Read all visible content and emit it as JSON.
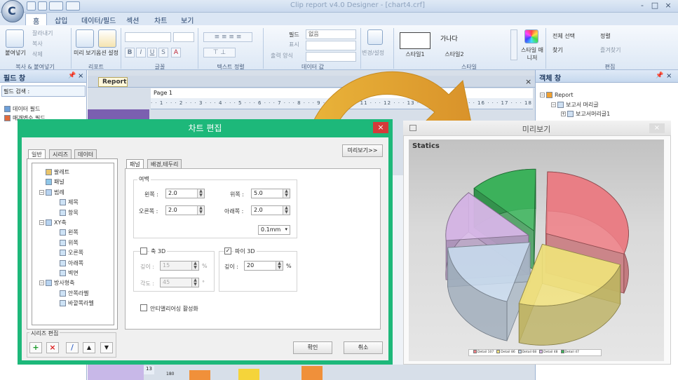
{
  "window": {
    "title": "Clip report v4.0 Designer - [chart4.crf]",
    "controls": [
      "-",
      "□",
      "×"
    ]
  },
  "ribbon": {
    "tabs": [
      "홈",
      "삽입",
      "데이터/필드",
      "섹션",
      "차트",
      "보기"
    ],
    "active_tab": "홈",
    "clipboard": {
      "paste": "붙여넣기",
      "cut": "잘라내기",
      "copy": "복사",
      "delete": "삭제",
      "group": "복사 & 붙여넣기"
    },
    "report": {
      "preview": "미리 보기",
      "option": "옵션 설정",
      "group": "리포트"
    },
    "font_group": "글꼴",
    "text_align_group": "텍스트 정렬",
    "data_value": {
      "field": "필드",
      "field_value": "없음",
      "format": "표시",
      "output_format": "출력 양식",
      "group": "데이터 값"
    },
    "change": {
      "label": "변경/설정"
    },
    "style": {
      "style1_sample": "",
      "style1": "스타일1",
      "style2_sample": "가나다",
      "style2": "스타일2",
      "manager": "스타일 매니저",
      "group": "스타일"
    },
    "edit": {
      "select_all": "전체 선택",
      "sort": "정렬",
      "find": "찾기",
      "favorite": "즐겨찾기",
      "group": "편집"
    }
  },
  "field_pane": {
    "title": "필드 창",
    "search_label": "필드 검색 :",
    "items": [
      "데이터 필드",
      "매개변수 필드"
    ]
  },
  "report_area": {
    "tab": "Report",
    "page_label": "Page 1",
    "ruler": "· · 1 · · · 2 · · · 3 · · · 4 · · · 5 · · · 6 · · · 7 · · · 8 · · · 9 · · · 10 · · · 11 · · · 12 · · · 13 · · · 14 · · · 15 · · · 16 · · · 17 · · · 18",
    "row_label_13": "13",
    "row_label_180": "180"
  },
  "object_pane": {
    "title": "객체 창",
    "items": [
      "Report",
      "보고서 머리글",
      "보고서머리글1"
    ]
  },
  "dialog": {
    "title": "차트 편집",
    "preview_button": "미리보기>>",
    "left_tabs": [
      "일반",
      "시리즈",
      "데이터"
    ],
    "tree": [
      {
        "label": "팔레트",
        "level": 1
      },
      {
        "label": "패널",
        "level": 1
      },
      {
        "label": "범례",
        "level": 1
      },
      {
        "label": "제목",
        "level": 2
      },
      {
        "label": "항목",
        "level": 2
      },
      {
        "label": "XY축",
        "level": 1
      },
      {
        "label": "왼쪽",
        "level": 2
      },
      {
        "label": "위쪽",
        "level": 2
      },
      {
        "label": "오른쪽",
        "level": 2
      },
      {
        "label": "아래쪽",
        "level": 2
      },
      {
        "label": "벽면",
        "level": 2
      },
      {
        "label": "방사형축",
        "level": 1
      },
      {
        "label": "안쪽라벨",
        "level": 2
      },
      {
        "label": "바깥쪽라벨",
        "level": 2
      }
    ],
    "series_edit_label": "시리즈 편집",
    "series_buttons": [
      "+",
      "×",
      "/",
      "▲",
      "▼"
    ],
    "prop_tabs": [
      "패널",
      "배경,테두리"
    ],
    "margin_label": "여백",
    "left_label": "왼쪽 :",
    "left_value": "2.0",
    "top_label": "위쪽 :",
    "top_value": "5.0",
    "right_label": "오른쪽 :",
    "right_value": "2.0",
    "bottom_label": "아래쪽 :",
    "bottom_value": "2.0",
    "unit": "0.1mm",
    "axis3d_label": "축 3D",
    "axis3d_checked": false,
    "depth_label": "깊이 :",
    "depth_value": "15",
    "depth_unit": "%",
    "angle_label": "각도 :",
    "angle_value": "45",
    "angle_unit": "°",
    "pie3d_label": "파이 3D",
    "pie3d_checked": true,
    "pie_depth_label": "깊이 :",
    "pie_depth_value": "20",
    "pie_depth_unit": "%",
    "antialias_label": "안티앨리어싱 활성화",
    "ok": "확인",
    "cancel": "취소"
  },
  "preview": {
    "title": "미리보기",
    "chart_title": "Statics"
  },
  "chart_data": {
    "type": "pie",
    "title": "Statics",
    "series": [
      {
        "categories": [
          "Detail 107",
          "Detail 86",
          "Detail 68",
          "Detail 48",
          "Detail 47"
        ],
        "values": [
          107,
          86,
          68,
          48,
          47
        ]
      }
    ],
    "colors": [
      "#f07f86",
      "#f2e37e",
      "#c9dbee",
      "#d9b9ea",
      "#39b55a"
    ],
    "legend_position": "bottom",
    "exploded": true,
    "three_d": true
  },
  "colors": {
    "dialog_border": "#1db87a",
    "close_button": "#d63a3a",
    "arrow": "#e3a92a"
  }
}
